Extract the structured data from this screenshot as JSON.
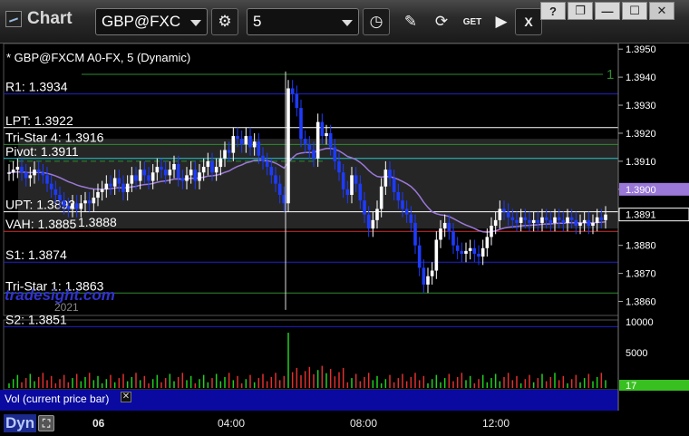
{
  "window": {
    "title": "Chart"
  },
  "toolbar": {
    "symbol": "GBP@FXC",
    "interval": "5",
    "buttons": [
      {
        "name": "settings-icon"
      },
      {
        "name": "clock-icon"
      },
      {
        "name": "pencil-icon"
      },
      {
        "name": "indicator-icon"
      },
      {
        "name": "get-icon",
        "label": "GET"
      },
      {
        "name": "play-icon"
      },
      {
        "name": "close-icon",
        "label": "X"
      }
    ],
    "window_buttons": {
      "help": "?",
      "restore": "❐",
      "minimize": "—",
      "maximize": "☐",
      "close": "✕"
    }
  },
  "chart_header": "* GBP@FXCM A0-FX, 5 (Dynamic)",
  "watermark": "tradesight.com",
  "watermark_year": "2021",
  "price_levels": [
    {
      "label": "R1: 1.3934",
      "price": 1.3934,
      "color": "#2020c8"
    },
    {
      "label": "LPT: 1.3922",
      "price": 1.3922,
      "color": "#ffffff"
    },
    {
      "label": "Tri-Star 4: 1.3916",
      "price": 1.3916,
      "color": "#2e8b2e"
    },
    {
      "label": "Pivot: 1.3911",
      "price": 1.3911,
      "color": "#27c9c9"
    },
    {
      "label": "UPT: 1.3892",
      "price": 1.3892,
      "color": "#ffffff"
    },
    {
      "label": "VAH: 1.3885",
      "price": 1.3885,
      "color": "#d03030"
    },
    {
      "label": "S1: 1.3874",
      "price": 1.3874,
      "color": "#2020c8"
    },
    {
      "label": "Tri-Star 1: 1.3863",
      "price": 1.3863,
      "color": "#2e8b2e"
    },
    {
      "label": "S2: 1.3851",
      "price": 1.3851,
      "color": "#2020c8"
    }
  ],
  "extra_label": "1.3888",
  "signal_label": "1",
  "chart_data": {
    "type": "candlestick",
    "series_name": "GBP@FXCM A0-FX, 5",
    "y_ticks": [
      "1.3950",
      "1.3940",
      "1.3930",
      "1.3920",
      "1.3910",
      "1.3900",
      "1.3880",
      "1.3870",
      "1.3860"
    ],
    "ylim": [
      1.3855,
      1.3952
    ],
    "price_tags": {
      "vwap": "1.3900",
      "last": "1.3891"
    },
    "close_series": [
      1.3906,
      1.3907,
      1.3908,
      1.3906,
      1.3904,
      1.3905,
      1.3907,
      1.3906,
      1.3905,
      1.3902,
      1.39,
      1.3898,
      1.3896,
      1.3894,
      1.3893,
      1.3895,
      1.3893,
      1.3895,
      1.3896,
      1.3895,
      1.3897,
      1.3899,
      1.39,
      1.3902,
      1.3901,
      1.3904,
      1.3902,
      1.3899,
      1.3902,
      1.3905,
      1.3903,
      1.3907,
      1.3905,
      1.3903,
      1.3906,
      1.3908,
      1.3907,
      1.3905,
      1.3907,
      1.3909,
      1.3904,
      1.3903,
      1.3905,
      1.3907,
      1.3903,
      1.3906,
      1.3908,
      1.391,
      1.3906,
      1.3908,
      1.3911,
      1.3914,
      1.3913,
      1.3919,
      1.3918,
      1.3916,
      1.3919,
      1.3915,
      1.3917,
      1.3912,
      1.391,
      1.3908,
      1.3905,
      1.3902,
      1.3898,
      1.3895,
      1.3936,
      1.3934,
      1.3929,
      1.3918,
      1.3916,
      1.3914,
      1.3911,
      1.3924,
      1.3919,
      1.392,
      1.3915,
      1.391,
      1.3906,
      1.39,
      1.3898,
      1.3905,
      1.3902,
      1.3896,
      1.3891,
      1.3886,
      1.3889,
      1.3893,
      1.3901,
      1.3907,
      1.3904,
      1.3899,
      1.3896,
      1.3893,
      1.3891,
      1.3888,
      1.388,
      1.3872,
      1.3866,
      1.3869,
      1.3871,
      1.3882,
      1.3886,
      1.3888,
      1.3885,
      1.388,
      1.3878,
      1.3877,
      1.3878,
      1.3879,
      1.3877,
      1.3876,
      1.3879,
      1.3883,
      1.3887,
      1.3889,
      1.3893,
      1.3892,
      1.389,
      1.3889,
      1.3888,
      1.389,
      1.3889,
      1.3888,
      1.3889,
      1.3888,
      1.389,
      1.3889,
      1.3888,
      1.389,
      1.3889,
      1.3888,
      1.389,
      1.3889,
      1.3887,
      1.3888,
      1.3889,
      1.3887,
      1.3888,
      1.389,
      1.3889,
      1.3891
    ],
    "volume_ticks": [
      "10000",
      "5000"
    ],
    "volume_tag": "17",
    "volume_label": "Vol (current price bar)",
    "x_ticks": [
      "06",
      "04:00",
      "08:00",
      "12:00"
    ]
  },
  "status": {
    "mode": "Dyn"
  },
  "colors": {
    "up": "#ffffff",
    "down": "#1d3bff",
    "vwap": "#9a78d8",
    "volume_up": "#20d020",
    "volume_down": "#e03030"
  }
}
